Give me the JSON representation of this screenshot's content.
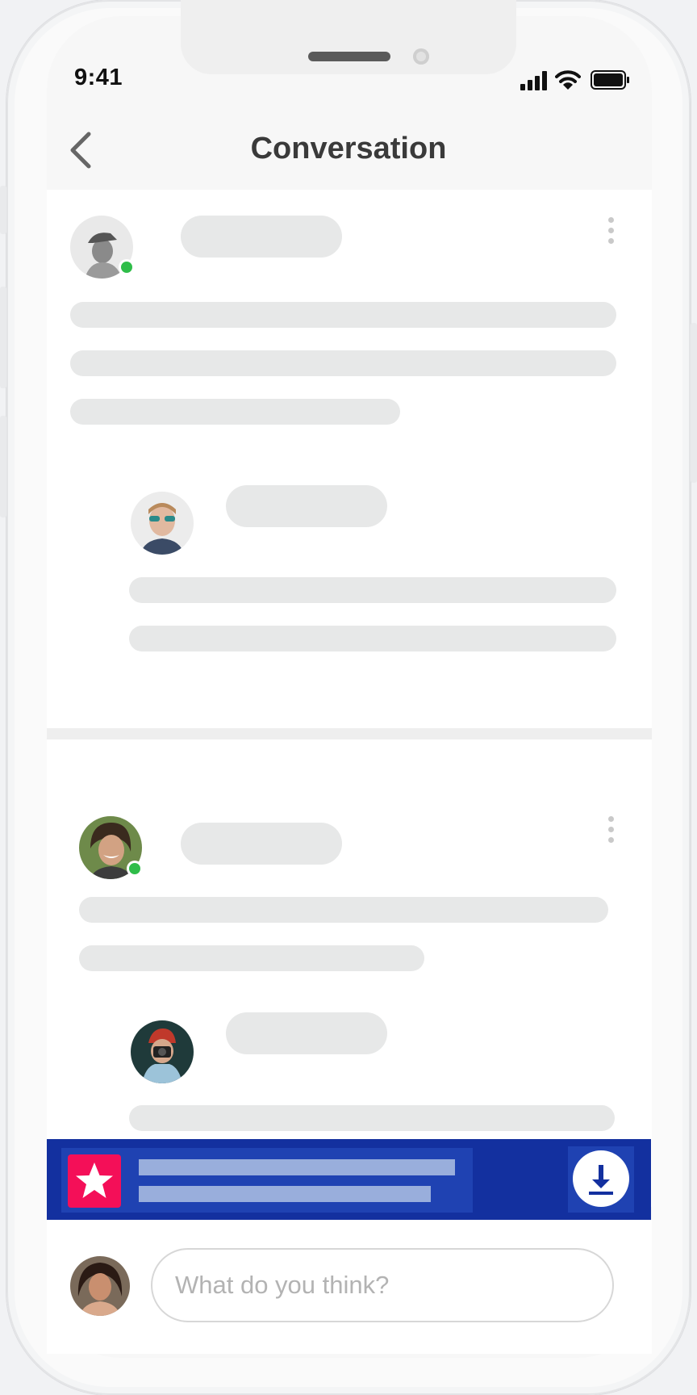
{
  "status_bar": {
    "time": "9:41"
  },
  "header": {
    "title": "Conversation",
    "back_icon": "chevron-left-icon"
  },
  "posts": [
    {
      "avatar": "avatar-man-cap",
      "online": true,
      "replies": [
        {
          "avatar": "avatar-man-sunglasses",
          "online": false
        }
      ]
    },
    {
      "avatar": "avatar-woman-smiling",
      "online": true,
      "replies": [
        {
          "avatar": "avatar-person-camera",
          "online": false
        }
      ]
    }
  ],
  "ad_banner": {
    "icon": "star-icon",
    "action_icon": "download-icon",
    "colors": {
      "background": "#13309f",
      "icon_bg": "#f40f58",
      "placeholder": "#99aedc"
    }
  },
  "composer": {
    "placeholder": "What do you think?",
    "avatar": "avatar-woman-curly"
  },
  "colors": {
    "online_dot": "#2fbd49",
    "skeleton": "#e7e8e8",
    "title_text": "#3a3a3a"
  }
}
